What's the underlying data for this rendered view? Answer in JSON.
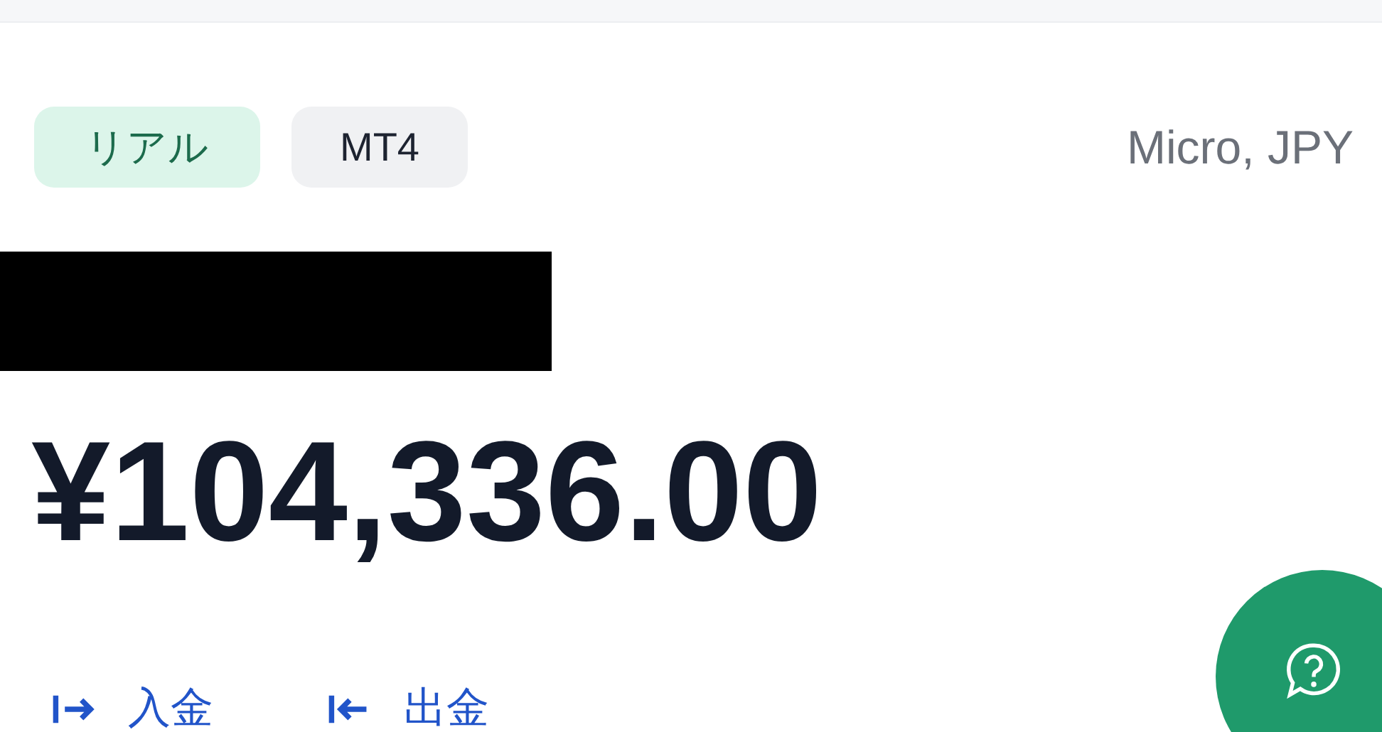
{
  "account": {
    "tags": [
      {
        "label": "リアル",
        "kind": "real"
      },
      {
        "label": "MT4",
        "kind": "platform"
      }
    ],
    "type": "Micro, JPY",
    "balance": "¥104,336.00",
    "actions": [
      {
        "label": "入金",
        "kind": "deposit"
      },
      {
        "label": "出金",
        "kind": "withdraw"
      }
    ]
  }
}
